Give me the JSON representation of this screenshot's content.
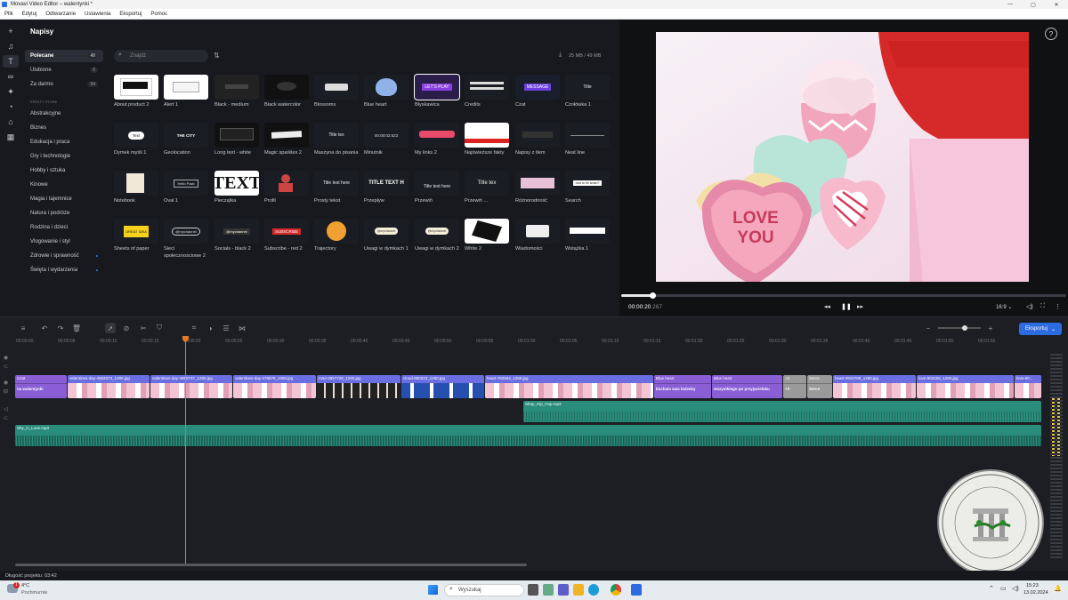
{
  "window": {
    "title": "Movavi Video Editor – walentynki *",
    "controls": [
      "—",
      "▢",
      "✕"
    ]
  },
  "menu": [
    "Plik",
    "Edytuj",
    "Odtwarzanie",
    "Ustawienia",
    "Eksportuj",
    "Pomoc"
  ],
  "panel": {
    "title": "Napisy",
    "search_placeholder": "Znajdź",
    "storage": "25 MB / 49 MB",
    "tabs": [
      {
        "label": "Polecane",
        "count": "40"
      },
      {
        "label": "Ulubione",
        "count": "0"
      },
      {
        "label": "Za darmo",
        "count": "54"
      }
    ],
    "section_label": "EFEKTY STORE",
    "categories": [
      "Abstrakcyjne",
      "Biznes",
      "Edukacja i praca",
      "Gry i technologie",
      "Hobby i sztuka",
      "Kinowe",
      "Magia i tajemnice",
      "Natura i podróże",
      "Rodzina i dzieci",
      "Vlogowanie i styl",
      "Zdrowie i sprawność",
      "Święta i wydarzenia"
    ],
    "tiles": [
      [
        "About product 2",
        "Alert 1",
        "Black - medium",
        "Black watercolor",
        "Blossoms",
        "Blue heart",
        "Błyskawica",
        "Credits",
        "Czat",
        "Czołówka 1"
      ],
      [
        "Dymek myśli 1",
        "Geolocation",
        "Long text - white",
        "Magic sparkles 2",
        "Maszyna do pisania",
        "Minutnik",
        "My links 2",
        "Najświeższe fakty",
        "Napisy z tłem",
        "Neat line"
      ],
      [
        "Notebook",
        "Oval 1",
        "Pieczątka",
        "Profil",
        "Prosty tekst",
        "Przepływ",
        "Przewiń",
        "Przewiń ...",
        "Różnorodność",
        "Search"
      ],
      [
        "Sheets of paper",
        "Sieci społecznościowe 2",
        "Socials - black 2",
        "Subscribe - red 2",
        "Trajectory",
        "Uwagi w dymkach 1",
        "Uwagi w dymkach 2",
        "White 2",
        "Wiadomości",
        "Wstążka 1"
      ]
    ],
    "tile_texts": {
      "text_big": "TEXT",
      "title": "Title text here",
      "title_upper": "TITLE TEXT H",
      "lets_play": "LET'S PLAY",
      "message": "MESSAGE",
      "subscribe": "SUBSCRIBE",
      "great": "GREAT IDEA",
      "channel": "@mychannel",
      "timer": "00:00:02:523",
      "city": "THE CITY",
      "hello": "Hello Pack",
      "text": "Text",
      "title_tex": "Title tex",
      "title_small": "Title text here",
      "search": "how to be smart?",
      "tytul": "Title",
      "tytul_sub": "Name Description"
    }
  },
  "preview": {
    "help": "?",
    "time_current": "00:00:20",
    "time_ms": ".267",
    "aspect": "16:9",
    "progress": 0.07,
    "image_text": [
      "LOVE",
      "YOU"
    ]
  },
  "timeline": {
    "ruler": [
      "00:00:00",
      "00:00:05",
      "00:00:10",
      "00:00:15",
      "00:00:20",
      "00:00:25",
      "00:00:30",
      "00:00:35",
      "00:00:40",
      "00:00:45",
      "00:00:50",
      "00:00:55",
      "00:01:00",
      "00:01:05",
      "00:01:10",
      "00:01:15",
      "00:01:20",
      "00:01:25",
      "00:01:30",
      "00:01:35",
      "00:01:40",
      "00:01:45",
      "00:01:50",
      "00:01:55"
    ],
    "export_label": "Eksportuj",
    "title_clips": [
      {
        "name": "Czat",
        "sub": "na walentynki",
        "color": "#8a5fd6"
      },
      {
        "name": "Blue heart",
        "sub": "kocham was koledzy",
        "color": "#8a5fd6"
      },
      {
        "name": "Blue heart",
        "sub": "wszystkiego po przyjacielsku",
        "color": "#8a5fd6"
      },
      {
        "name": "+3",
        "sub": "+3",
        "color": "#9a9a9a"
      },
      {
        "name": "Serce",
        "sub": "Serce",
        "color": "#9a9a9a"
      }
    ],
    "video_clips": [
      "valentines-day-4583373_1280.jpg",
      "valentines-day-4999737_1280.jpg",
      "valentines-day-478879_1280.jpg",
      "rose-3957728_1280.jpg",
      "cloud-890224_1280.jpg",
      "heart-782564_1280.jpg",
      "heart-3934788_1280.jpg",
      "love-903156_1280.jpg",
      "love-90..."
    ],
    "audio_tracks": [
      "Shop_Hip_Hop.mp3",
      "Shy_in_Love.mp3"
    ]
  },
  "status": {
    "duration": "Długość projektu: 03:42"
  },
  "taskbar": {
    "weather_temp": "4°C",
    "weather_desc": "Pochmurnie",
    "badge": "1",
    "search": "Wyszukaj",
    "time": "15:23",
    "date": "13.02.2024"
  },
  "stamp_text": "GMINNY OŚRODEK KULTURY W STAWICZEŃIE"
}
